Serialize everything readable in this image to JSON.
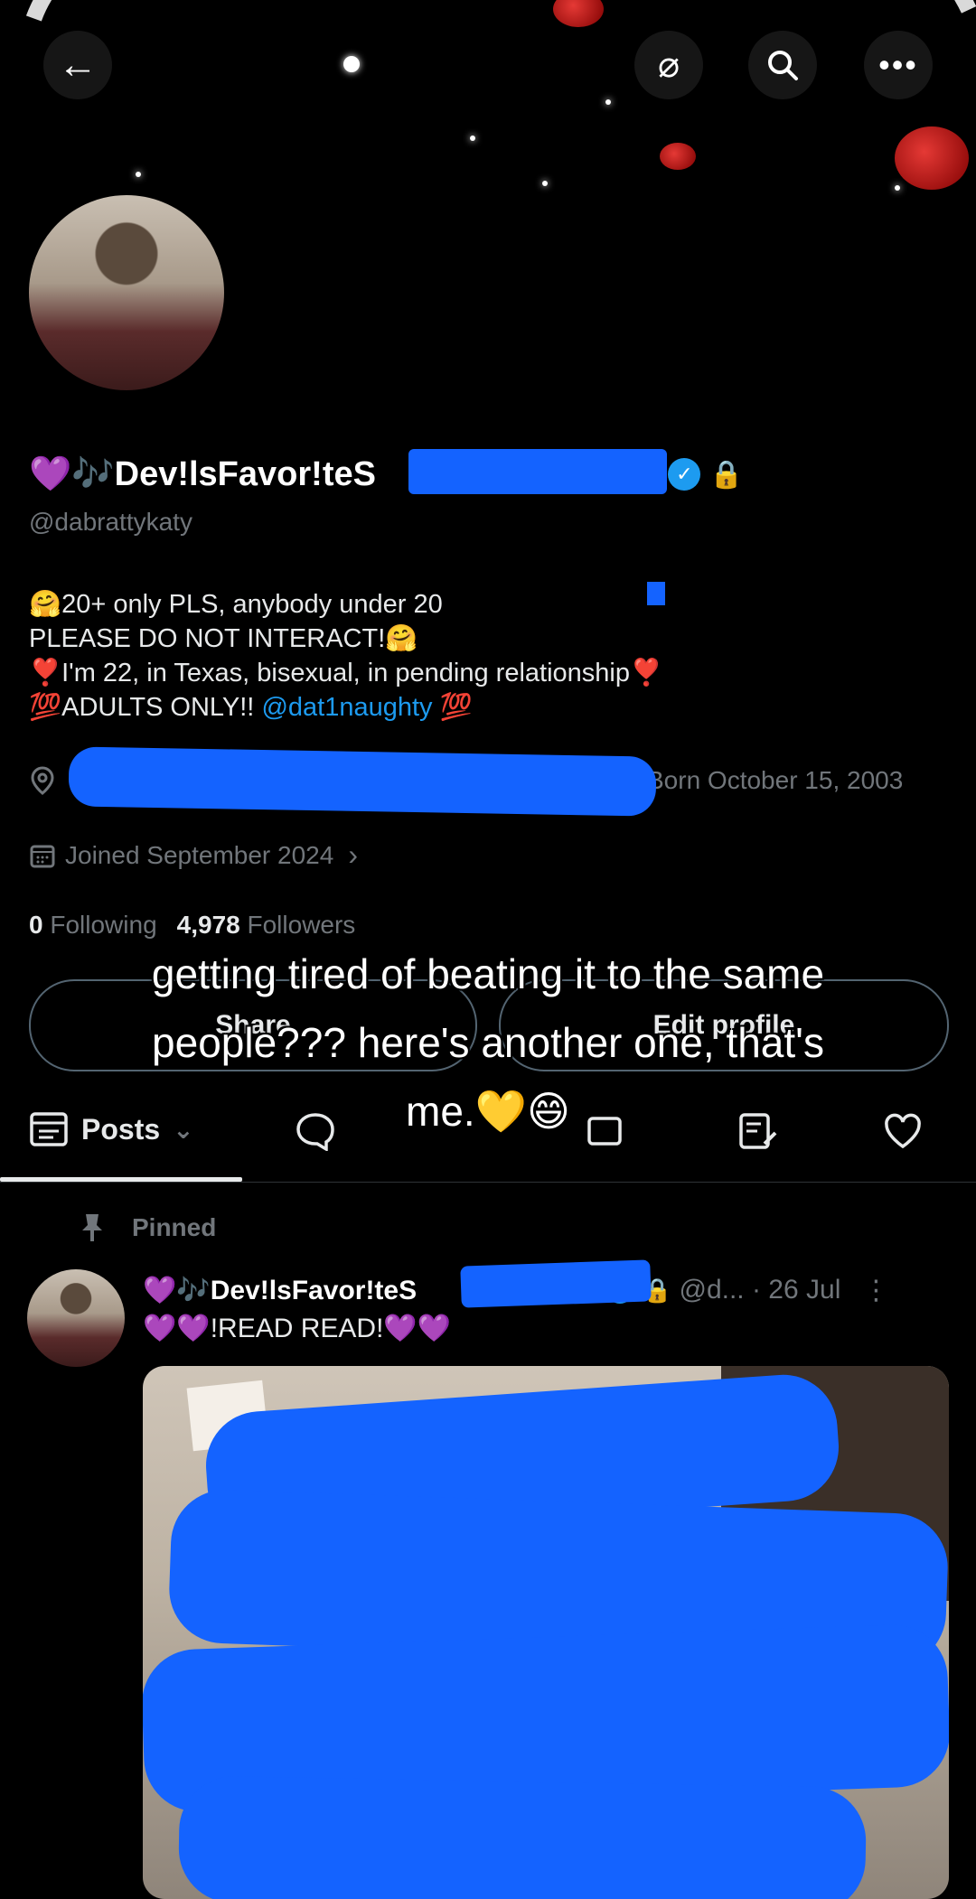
{
  "header": {
    "back_icon": "arrow-left-icon",
    "grok_icon": "grok-icon",
    "search_icon": "search-icon",
    "more_icon": "more-icon"
  },
  "profile": {
    "name_prefix": "💜🎶Dev!lsFavor!teS",
    "name_suffix": "💜",
    "handle": "@dabrattykaty",
    "bio": [
      "🤗20+ only PLS, anybody under 20",
      "PLEASE DO NOT INTERACT!🤗",
      "❣️I'm 22, in Texas, bisexual, in pending relationship❣️",
      "💯ADULTS ONLY!!"
    ],
    "bio_mention": "@dat1naughty",
    "bio_mention_suffix": "💯",
    "location_icon": "location-pin-icon",
    "born": "Born October 15, 2003",
    "joined": "Joined September 2024",
    "following_count": "0",
    "following_label": "Following",
    "followers_count": "4,978",
    "followers_label": "Followers",
    "share_label": "Share",
    "edit_profile_label": "Edit profile"
  },
  "caption": {
    "line1": "getting tired of beating it to the same",
    "line2": "people??? here's another one, that's",
    "line3": "me.💛😄"
  },
  "tabs": {
    "posts_label": "Posts"
  },
  "pinned_post": {
    "pinned_label": "Pinned",
    "author": "💜🎶Dev!lsFavor!teS",
    "handle_time": "@d... · 26 Jul",
    "text": "💜💜!READ READ!💜💜"
  },
  "colors": {
    "background": "#000000",
    "text_primary": "#e7e9ea",
    "text_secondary": "#71767b",
    "accent": "#1d9bf0",
    "redaction": "#1463ff"
  }
}
